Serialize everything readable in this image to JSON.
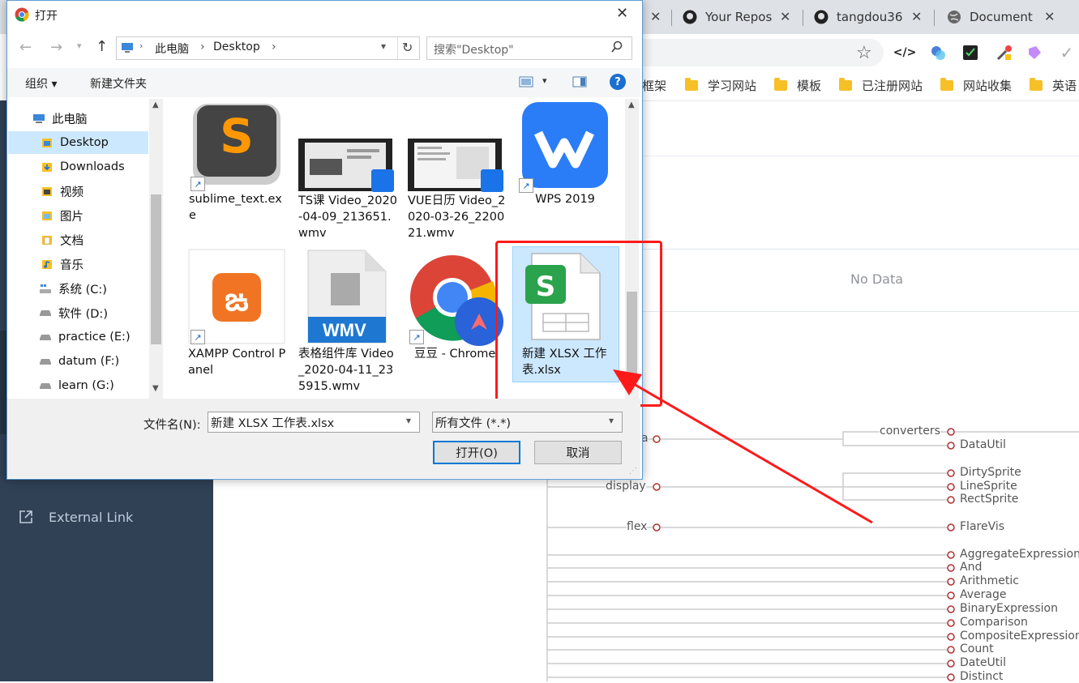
{
  "browser": {
    "tabs": [
      {
        "title": "Your Repos"
      },
      {
        "title": "tangdou36"
      },
      {
        "title": "Document"
      }
    ],
    "close_glyph": "✕",
    "star_icon": "☆",
    "bookmarks": [
      {
        "label": "框架"
      },
      {
        "label": "学习网站"
      },
      {
        "label": "模板"
      },
      {
        "label": "已注册网站"
      },
      {
        "label": "网站收集"
      },
      {
        "label": "英语"
      }
    ]
  },
  "page": {
    "sidebar": {
      "external_link": "External Link"
    },
    "no_data": "No Data",
    "tree": {
      "left_nodes": [
        "a",
        "display",
        "flex"
      ],
      "right_top": [
        "converters",
        "DataUtil"
      ],
      "display_children": [
        "DirtySprite",
        "LineSprite",
        "RectSprite"
      ],
      "flex_children": [
        "FlareVis"
      ],
      "query_children": [
        "AggregateExpression",
        "And",
        "Arithmetic",
        "Average",
        "BinaryExpression",
        "Comparison",
        "CompositeExpression",
        "Count",
        "DateUtil",
        "Distinct"
      ]
    }
  },
  "dialog": {
    "title": "打开",
    "path": [
      "此电脑",
      "Desktop"
    ],
    "search_placeholder": "搜索\"Desktop\"",
    "toolbar": {
      "organize": "组织 ▾",
      "new_folder": "新建文件夹",
      "help": "?"
    },
    "nav": [
      {
        "label": "此电脑",
        "icon": "computer-icon"
      },
      {
        "label": "Desktop",
        "icon": "desktop-folder-icon"
      },
      {
        "label": "Downloads",
        "icon": "downloads-icon"
      },
      {
        "label": "视频",
        "icon": "videos-icon"
      },
      {
        "label": "图片",
        "icon": "pictures-icon"
      },
      {
        "label": "文档",
        "icon": "documents-icon"
      },
      {
        "label": "音乐",
        "icon": "music-icon"
      },
      {
        "label": "系统 (C:)",
        "icon": "drive-icon"
      },
      {
        "label": "软件 (D:)",
        "icon": "drive-icon"
      },
      {
        "label": "practice (E:)",
        "icon": "drive-icon"
      },
      {
        "label": "datum (F:)",
        "icon": "drive-icon"
      },
      {
        "label": "learn (G:)",
        "icon": "drive-icon"
      }
    ],
    "files": [
      {
        "name": "sublime_text.exe"
      },
      {
        "name": "TS课 Video_2020-04-09_213651.wmv"
      },
      {
        "name": "VUE日历 Video_2020-03-26_220021.wmv"
      },
      {
        "name": "WPS 2019"
      },
      {
        "name": "XAMPP Control Panel"
      },
      {
        "name": "表格组件库 Video_2020-04-11_235915.wmv"
      },
      {
        "name": "豆豆 - Chrome"
      },
      {
        "name": "新建 XLSX 工作表.xlsx"
      }
    ],
    "wmv_badge": "WMV",
    "filename_label": "文件名(N):",
    "filename_value": "新建 XLSX 工作表.xlsx",
    "filetype_value": "所有文件 (*.*)",
    "open_button": "打开(O)",
    "cancel_button": "取消"
  },
  "colors": {
    "annotation_red": "#ff1a1a",
    "selection": "#cce8ff",
    "sidebar": "#304156"
  }
}
